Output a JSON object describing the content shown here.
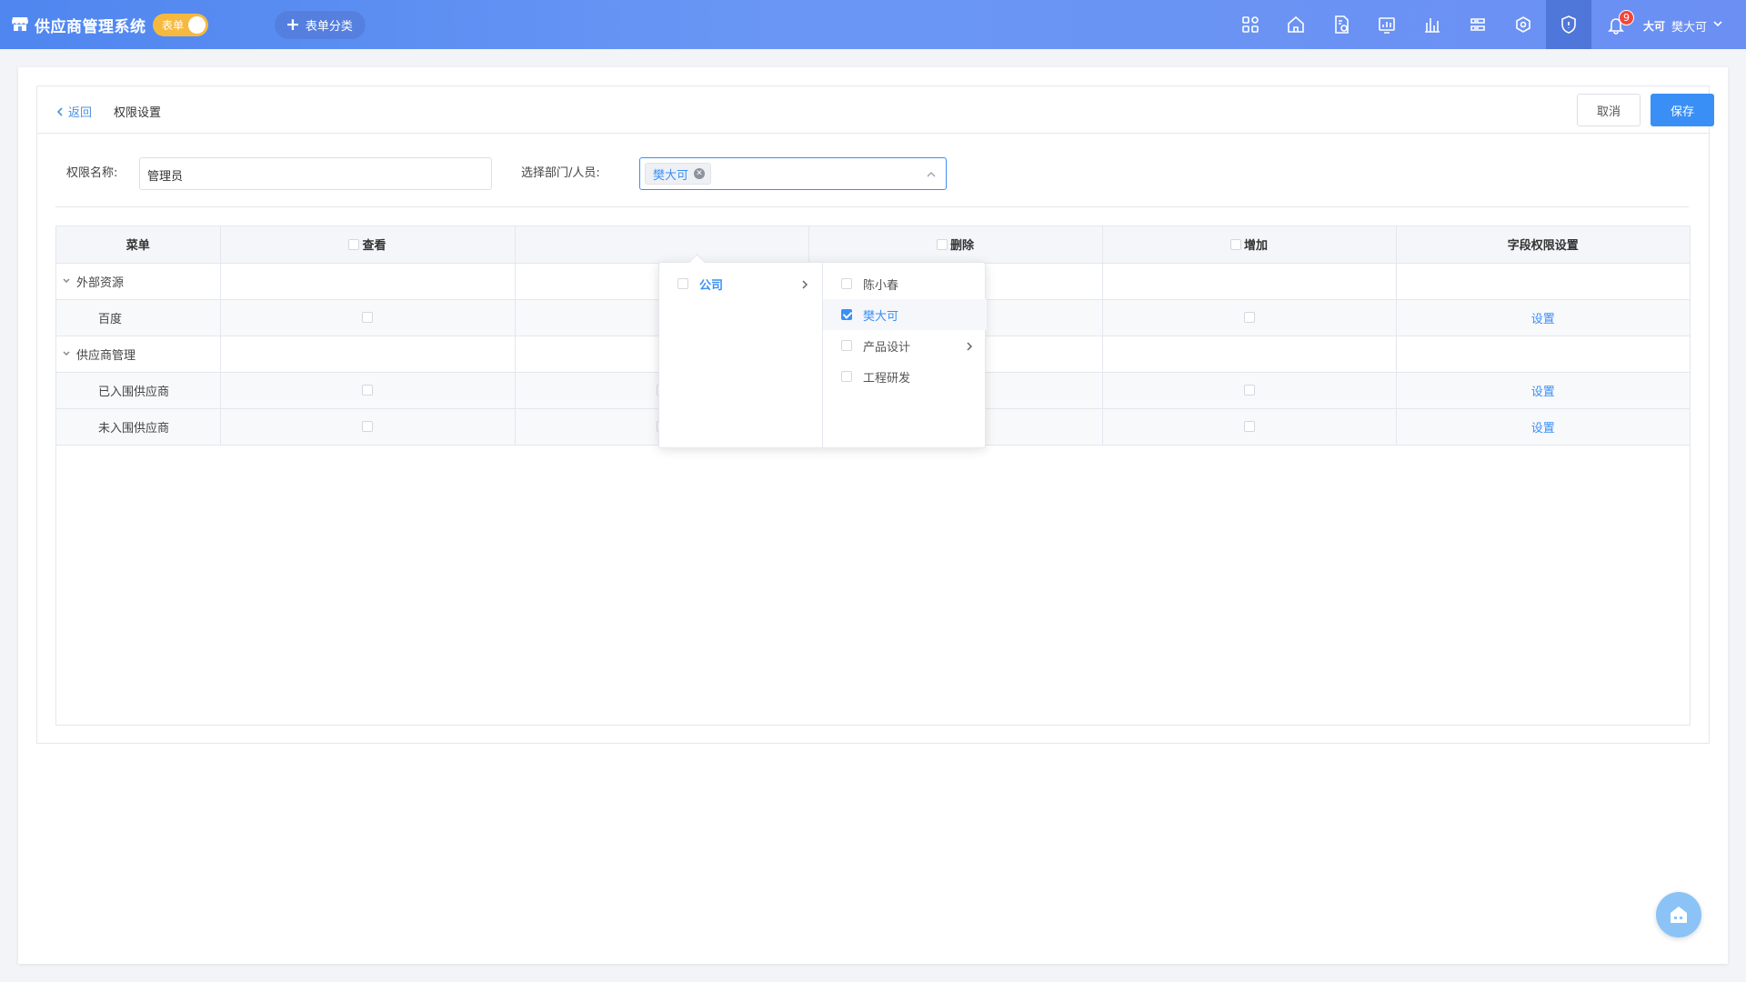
{
  "header": {
    "title": "供应商管理系统",
    "toggle_label": "表单",
    "add_category_label": "表单分类",
    "notification_count": "9",
    "user_avatar_text": "大可",
    "user_name": "樊大可",
    "gradient": [
      "#4f86ef",
      "#6b8ff3"
    ]
  },
  "page": {
    "back_label": "返回",
    "title": "权限设置",
    "cancel_label": "取消",
    "save_label": "保存"
  },
  "form": {
    "name_label": "权限名称:",
    "name_value": "管理员",
    "dept_label": "选择部门/人员:",
    "selected_tag": "樊大可"
  },
  "dropdown": {
    "left": [
      {
        "label": "公司",
        "has_children": true,
        "active": true
      }
    ],
    "right": [
      {
        "label": "陈小春",
        "checked": false
      },
      {
        "label": "樊大可",
        "checked": true
      },
      {
        "label": "产品设计",
        "checked": false,
        "has_children": true
      },
      {
        "label": "工程研发",
        "checked": false
      }
    ]
  },
  "table": {
    "headers": [
      "菜单",
      "查看",
      "",
      "删除",
      "增加",
      "字段权限设置"
    ],
    "rows": [
      {
        "type": "group",
        "name": "外部资源"
      },
      {
        "type": "child",
        "name": "百度",
        "action": "设置"
      },
      {
        "type": "group",
        "name": "供应商管理"
      },
      {
        "type": "child",
        "name": "已入围供应商",
        "action": "设置"
      },
      {
        "type": "child",
        "name": "未入围供应商",
        "action": "设置"
      }
    ]
  },
  "colors": {
    "primary": "#3a8ff7",
    "toggle": "#f6b940",
    "badge": "#f5453b"
  }
}
